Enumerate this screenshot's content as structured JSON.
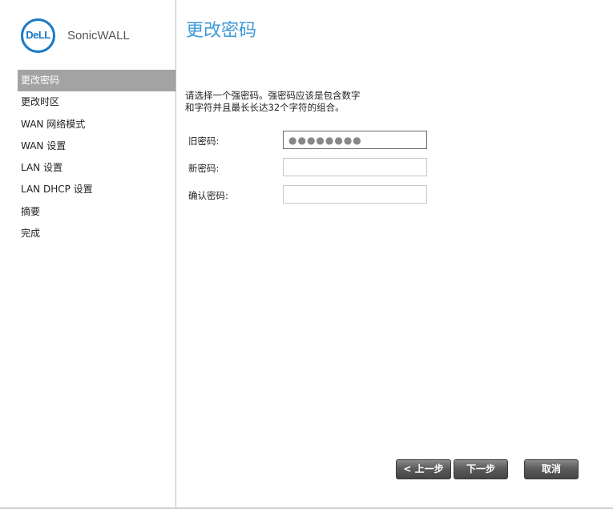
{
  "logo": {
    "mark_text": "DeLL",
    "brand_text": "SonicWALL"
  },
  "sidebar": {
    "items": [
      {
        "label": "更改密码",
        "active": true
      },
      {
        "label": "更改时区",
        "active": false
      },
      {
        "label": "WAN 网络模式",
        "active": false
      },
      {
        "label": "WAN 设置",
        "active": false
      },
      {
        "label": "LAN 设置",
        "active": false
      },
      {
        "label": "LAN DHCP 设置",
        "active": false
      },
      {
        "label": "摘要",
        "active": false
      },
      {
        "label": "完成",
        "active": false
      }
    ]
  },
  "main": {
    "title": "更改密码",
    "instructions": "请选择一个强密码。强密码应该是包含数字\n和字符并且最长长达32个字符的组合。",
    "fields": {
      "old_password": {
        "label": "旧密码:",
        "value": "●●●●●●●●"
      },
      "new_password": {
        "label": "新密码:",
        "value": ""
      },
      "confirm_password": {
        "label": "确认密码:",
        "value": ""
      }
    }
  },
  "buttons": {
    "back": "< 上一步",
    "next": "下一步",
    "cancel": "取消"
  },
  "colors": {
    "accent": "#3d9ad6",
    "brand_blue": "#1879c6",
    "active_nav": "#a3a3a3",
    "button": "#5c5c5c"
  }
}
